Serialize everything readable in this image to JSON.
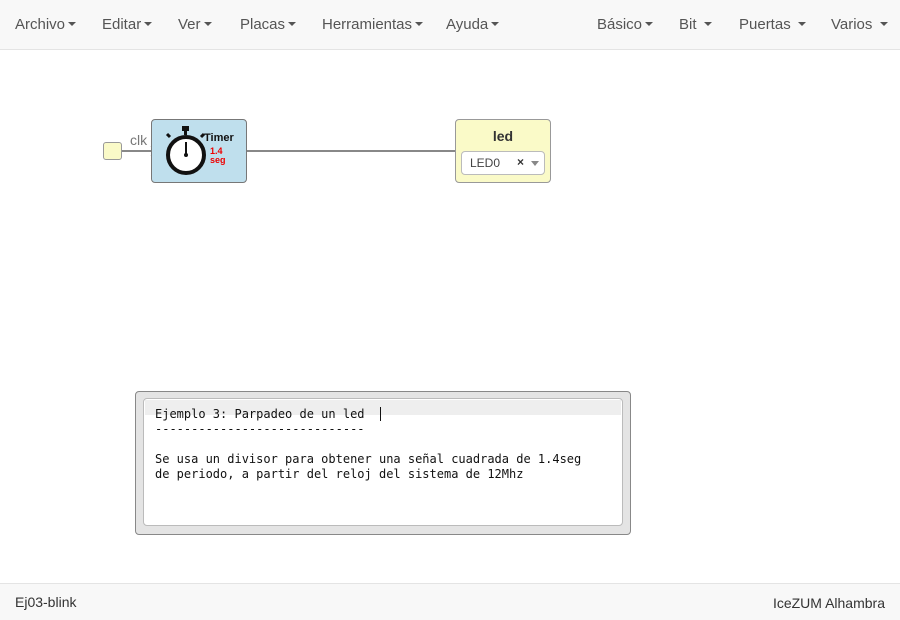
{
  "menubar": {
    "left": [
      {
        "label": "Archivo"
      },
      {
        "label": "Editar"
      },
      {
        "label": "Ver"
      },
      {
        "label": "Placas"
      },
      {
        "label": "Herramientas"
      },
      {
        "label": "Ayuda"
      }
    ],
    "right": [
      {
        "label": "Básico"
      },
      {
        "label": "Bit"
      },
      {
        "label": "Puertas"
      },
      {
        "label": "Varios"
      }
    ]
  },
  "canvas": {
    "clk_label": "clk",
    "timer_block": {
      "title": "Timer",
      "value": "1.4",
      "unit": "seg",
      "icon": "stopwatch-icon",
      "fill_color": "#bfdfed"
    },
    "led_block": {
      "title": "led",
      "selected_pin": "LED0",
      "clear_symbol": "×",
      "fill_color": "#fafac8"
    }
  },
  "comment": {
    "lines": [
      "Ejemplo 3: Parpadeo de un led",
      "-----------------------------",
      "",
      "Se usa un divisor para obtener una señal cuadrada de 1.4seg",
      "de periodo, a partir del reloj del sistema de 12Mhz"
    ]
  },
  "footer": {
    "project_name": "Ej03-blink",
    "board_name": "IceZUM Alhambra"
  }
}
